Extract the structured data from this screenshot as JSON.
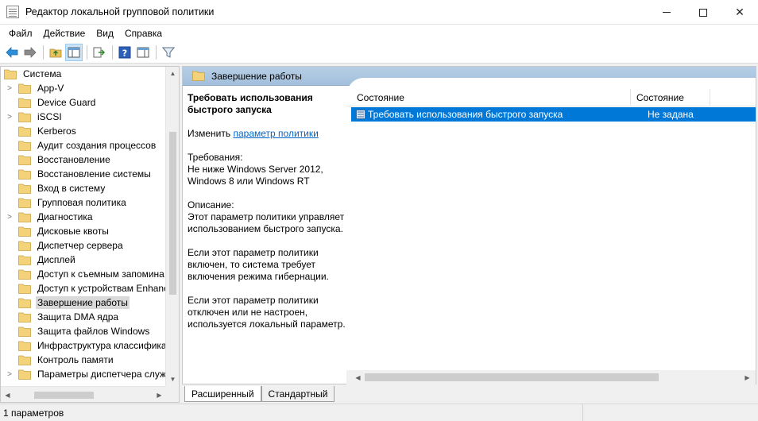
{
  "window": {
    "title": "Редактор локальной групповой политики"
  },
  "menu": [
    {
      "label": "Файл"
    },
    {
      "label": "Действие"
    },
    {
      "label": "Вид"
    },
    {
      "label": "Справка"
    }
  ],
  "tree": {
    "items": [
      {
        "label": "Система",
        "expander": "",
        "indent": 0,
        "selected": false
      },
      {
        "label": "App-V",
        "expander": ">",
        "indent": 1,
        "selected": false
      },
      {
        "label": "Device Guard",
        "expander": "",
        "indent": 1,
        "selected": false
      },
      {
        "label": "iSCSI",
        "expander": ">",
        "indent": 1,
        "selected": false
      },
      {
        "label": "Kerberos",
        "expander": "",
        "indent": 1,
        "selected": false
      },
      {
        "label": "Аудит создания процессов",
        "expander": "",
        "indent": 1,
        "selected": false
      },
      {
        "label": "Восстановление",
        "expander": "",
        "indent": 1,
        "selected": false
      },
      {
        "label": "Восстановление системы",
        "expander": "",
        "indent": 1,
        "selected": false
      },
      {
        "label": "Вход в систему",
        "expander": "",
        "indent": 1,
        "selected": false
      },
      {
        "label": "Групповая политика",
        "expander": "",
        "indent": 1,
        "selected": false
      },
      {
        "label": "Диагностика",
        "expander": ">",
        "indent": 1,
        "selected": false
      },
      {
        "label": "Дисковые квоты",
        "expander": "",
        "indent": 1,
        "selected": false
      },
      {
        "label": "Диспетчер сервера",
        "expander": "",
        "indent": 1,
        "selected": false
      },
      {
        "label": "Дисплей",
        "expander": "",
        "indent": 1,
        "selected": false
      },
      {
        "label": "Доступ к съемным запомина",
        "expander": "",
        "indent": 1,
        "selected": false
      },
      {
        "label": "Доступ к устройствам Enhanc",
        "expander": "",
        "indent": 1,
        "selected": false
      },
      {
        "label": "Завершение работы",
        "expander": "",
        "indent": 1,
        "selected": true
      },
      {
        "label": "Защита DMA ядра",
        "expander": "",
        "indent": 1,
        "selected": false
      },
      {
        "label": "Защита файлов Windows",
        "expander": "",
        "indent": 1,
        "selected": false
      },
      {
        "label": "Инфраструктура классифика",
        "expander": "",
        "indent": 1,
        "selected": false
      },
      {
        "label": "Контроль памяти",
        "expander": "",
        "indent": 1,
        "selected": false
      },
      {
        "label": "Параметры диспетчера служ",
        "expander": ">",
        "indent": 1,
        "selected": false
      }
    ]
  },
  "right": {
    "header_title": "Завершение работы",
    "desc_title": "Требовать использования быстрого запуска",
    "edit_prefix": "Изменить",
    "edit_link": "параметр политики",
    "req_label": "Требования:",
    "req_text": "Не ниже Windows Server 2012, Windows 8 или Windows RT",
    "desc_label": "Описание:",
    "desc_text": "Этот параметр политики управляет использованием быстрого запуска.",
    "desc_enabled": "Если этот параметр политики включен, то система требует включения режима гибернации.",
    "desc_disabled": "Если этот параметр политики отключен или не настроен, используется локальный параметр.",
    "columns": [
      "Состояние",
      "Состояние"
    ],
    "rows": [
      {
        "name": "Требовать использования быстрого запуска",
        "state": "Не задана"
      }
    ]
  },
  "tabs": [
    {
      "label": "Расширенный",
      "active": true
    },
    {
      "label": "Стандартный",
      "active": false
    }
  ],
  "status": {
    "text": "1 параметров"
  }
}
